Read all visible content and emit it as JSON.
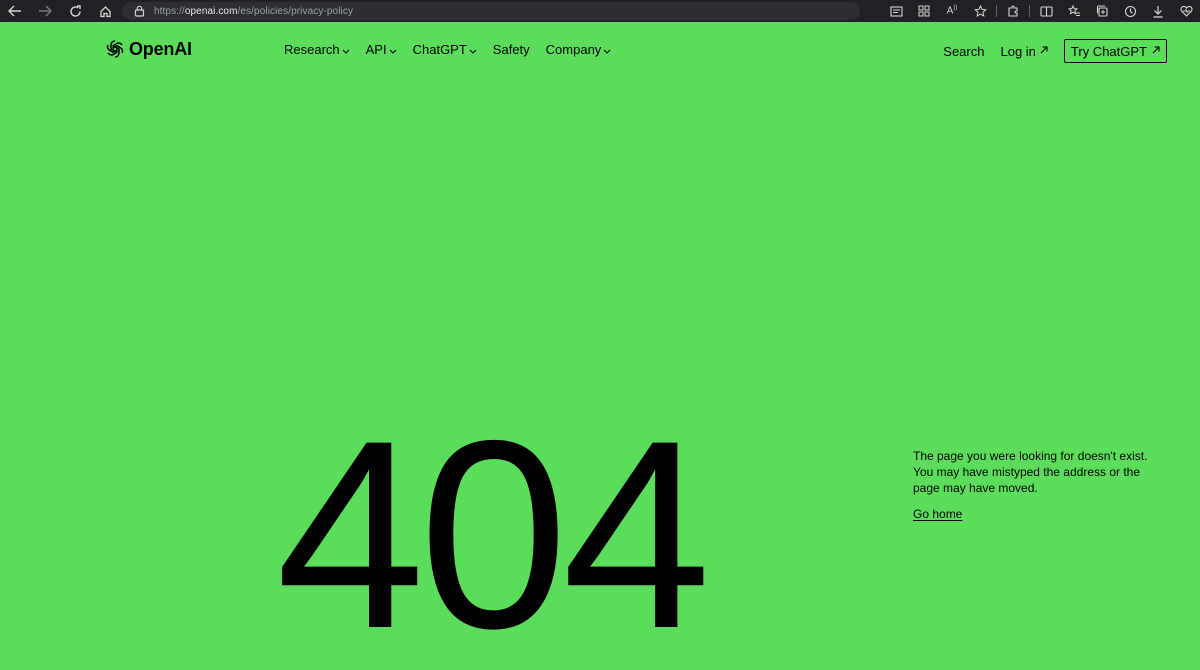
{
  "browser": {
    "url_scheme": "https://",
    "url_host": "openai.com",
    "url_path": "/es/policies/privacy-policy",
    "back_icon": "arrow-left-icon",
    "forward_icon": "arrow-right-icon",
    "refresh_icon": "refresh-icon",
    "home_icon": "home-icon",
    "lock_icon": "lock-icon"
  },
  "site": {
    "logo_text": "OpenAI",
    "nav": [
      {
        "label": "Research",
        "has_dropdown": true
      },
      {
        "label": "API",
        "has_dropdown": true
      },
      {
        "label": "ChatGPT",
        "has_dropdown": true
      },
      {
        "label": "Safety",
        "has_dropdown": false
      },
      {
        "label": "Company",
        "has_dropdown": true
      }
    ],
    "search_label": "Search",
    "login_label": "Log in",
    "try_label": "Try ChatGPT"
  },
  "error": {
    "code": "404",
    "message_line1": "The page you were looking for doesn't exist.",
    "message_line2": "You may have mistyped the address or the page may have moved.",
    "go_home_label": "Go home"
  },
  "colors": {
    "background": "#5bdd5b",
    "text": "#000000",
    "chrome": "#202124"
  }
}
